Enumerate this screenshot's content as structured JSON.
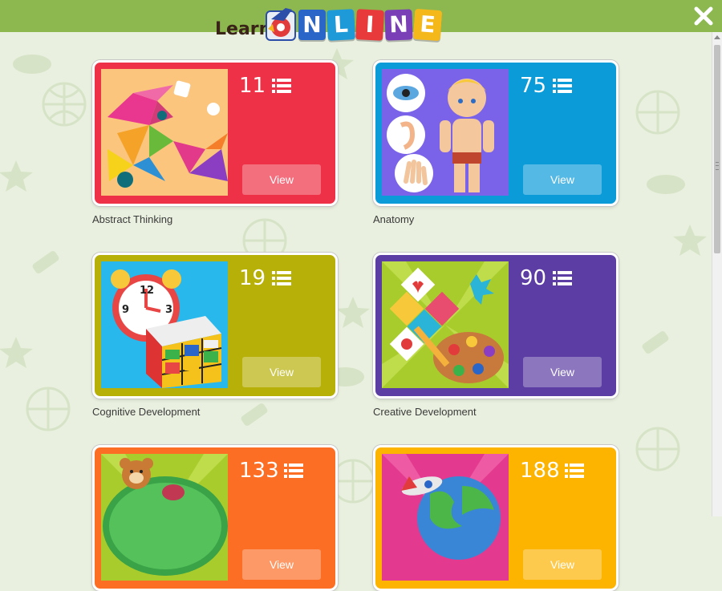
{
  "header": {
    "logo_learn": "Learn",
    "logo_letters": [
      "N",
      "L",
      "I",
      "N",
      "E"
    ],
    "logo_letter_colors": [
      "#2a65c8",
      "#1e9ad8",
      "#e83a3a",
      "#7a3fb7",
      "#f5b81b"
    ],
    "bar_color": "#8cb84f"
  },
  "categories": [
    {
      "label": "Abstract Thinking",
      "count": "11",
      "view": "View",
      "color": "#ee3147"
    },
    {
      "label": "Anatomy",
      "count": "75",
      "view": "View",
      "color": "#0b9bd8"
    },
    {
      "label": "Cognitive Development",
      "count": "19",
      "view": "View",
      "color": "#b7b008"
    },
    {
      "label": "Creative Development",
      "count": "90",
      "view": "View",
      "color": "#5b3da3"
    },
    {
      "label": "",
      "count": "133",
      "view": "View",
      "color": "#fc6e24"
    },
    {
      "label": "",
      "count": "188",
      "view": "View",
      "color": "#fcb400"
    }
  ],
  "icons": {
    "close": "close-icon",
    "list": "list-icon"
  }
}
